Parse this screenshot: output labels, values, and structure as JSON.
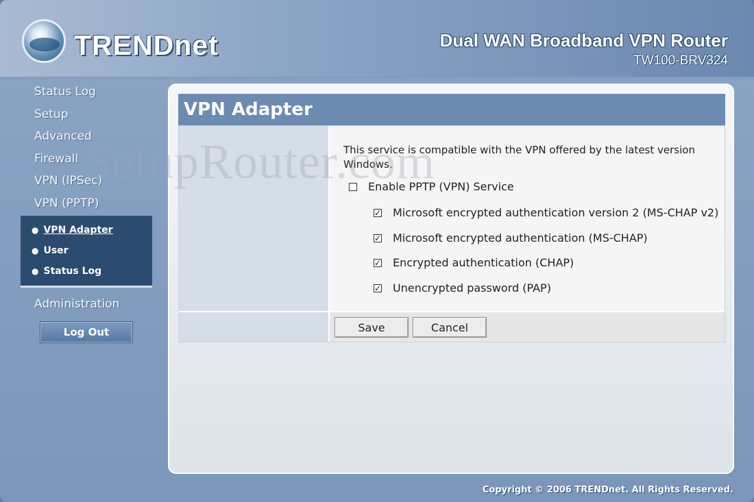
{
  "header": {
    "logo_text": "TRENDnet",
    "product_title": "Dual WAN Broadband VPN Router",
    "product_model": "TW100-BRV324"
  },
  "sidebar": {
    "items": [
      {
        "label": "Status Log"
      },
      {
        "label": "Setup"
      },
      {
        "label": "Advanced"
      },
      {
        "label": "Firewall"
      },
      {
        "label": "VPN (IPSec)"
      },
      {
        "label": "VPN (PPTP)"
      }
    ],
    "submenu": [
      {
        "label": "VPN Adapter",
        "active": true
      },
      {
        "label": "User"
      },
      {
        "label": "Status Log"
      }
    ],
    "admin_label": "Administration",
    "logout_label": "Log Out"
  },
  "panel": {
    "title": "VPN Adapter",
    "description": "This service is compatible with the VPN offered by the latest version Windows.",
    "enable_label": "Enable PPTP (VPN) Service",
    "enable_checked": false,
    "auth_options": [
      {
        "label": "Microsoft encrypted authentication version 2 (MS-CHAP v2)",
        "checked": true
      },
      {
        "label": "Microsoft encrypted authentication (MS-CHAP)",
        "checked": true
      },
      {
        "label": "Encrypted authentication (CHAP)",
        "checked": true
      },
      {
        "label": "Unencrypted password (PAP)",
        "checked": true
      }
    ],
    "save_label": "Save",
    "cancel_label": "Cancel"
  },
  "watermark": "SetupRouter.com",
  "footer": {
    "copyright": "Copyright © 2006 TRENDnet. All Rights Reserved."
  },
  "icons": {
    "logo": "trendnet-globe-icon",
    "bullet": "bullet-icon",
    "checkbox_checked_glyph": "☑",
    "checkbox_unchecked_glyph": "☐"
  },
  "colors": {
    "title_bar": "#6b8bb1",
    "submenu_bg": "#2b4b6f"
  }
}
